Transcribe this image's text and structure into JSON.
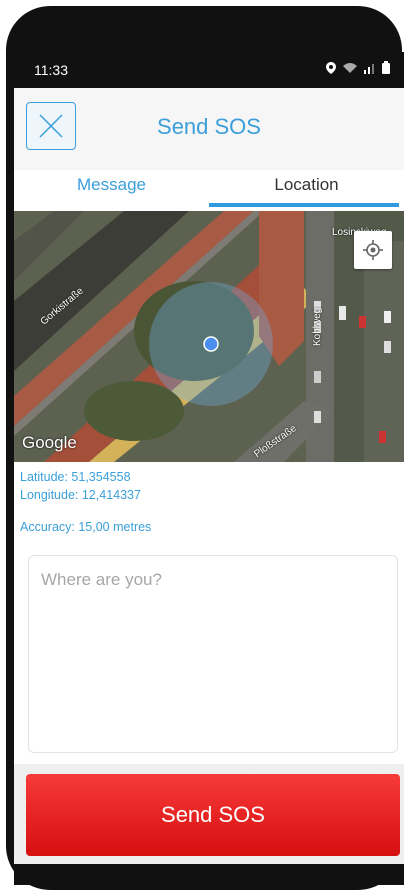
{
  "status_bar": {
    "time": "11:33"
  },
  "header": {
    "title": "Send SOS"
  },
  "tabs": [
    {
      "label": "Message"
    },
    {
      "label": "Location"
    }
  ],
  "map": {
    "street_labels": [
      "Gorkistraße",
      "Kohlweg",
      "Ploßstraße",
      "Losinskiweg"
    ],
    "brand": "Google"
  },
  "location": {
    "latitude": "Latitude: 51,354558",
    "longitude": "Longitude: 12,414337",
    "accuracy": "Accuracy: 15,00 metres"
  },
  "message_input": {
    "placeholder": "Where are you?"
  },
  "send_button": {
    "label": "Send SOS"
  },
  "colors": {
    "accent": "#3b9fd9",
    "sos_red": "#e61f1f"
  }
}
